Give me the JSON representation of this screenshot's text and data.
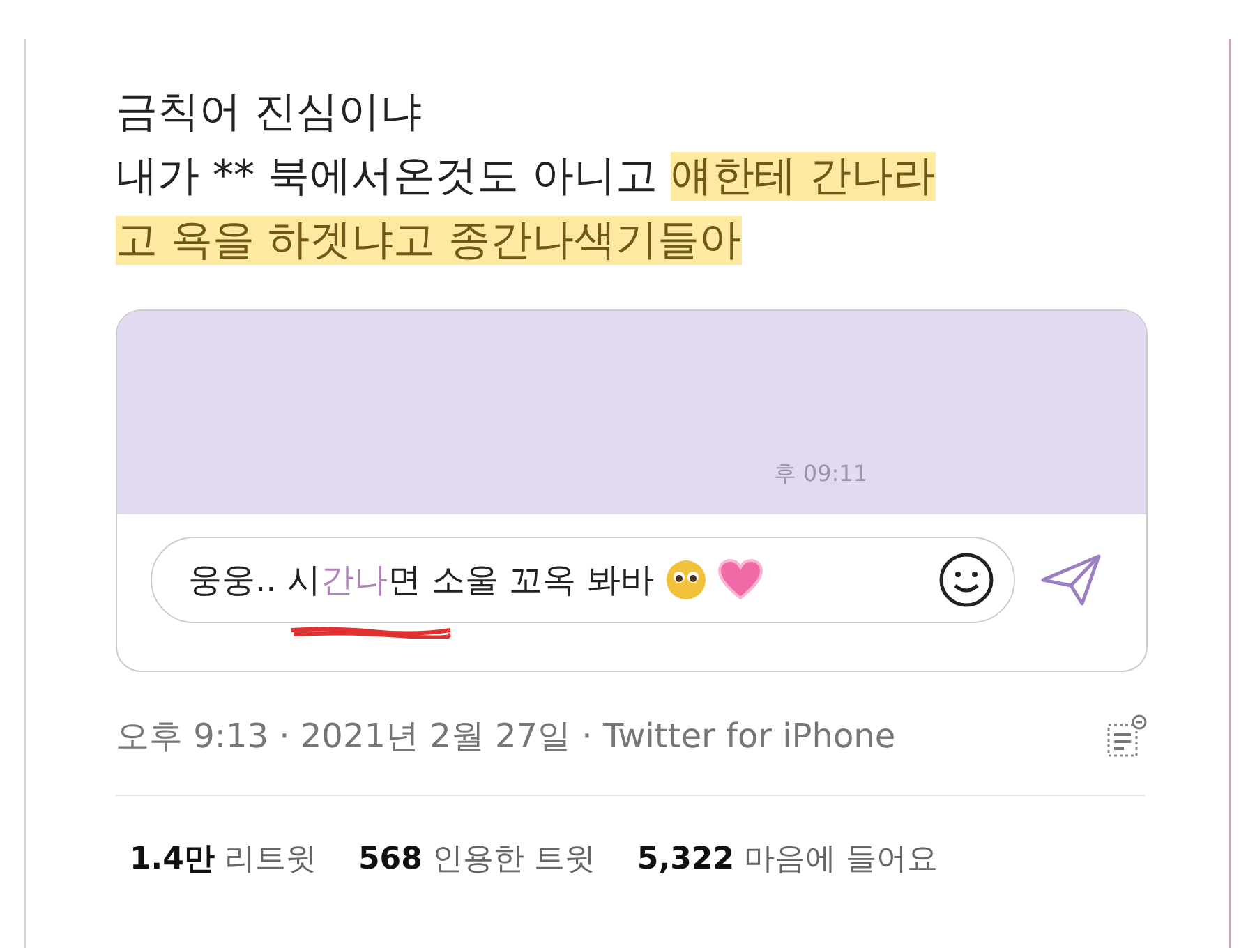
{
  "tweet": {
    "lines": [
      {
        "segments": [
          {
            "text": "금칙어 진심이냐",
            "highlighted": false
          }
        ]
      },
      {
        "segments": [
          {
            "text": "내가 ** 북에서온것도 아니고 ",
            "highlighted": false
          },
          {
            "text": "얘한테 간나라",
            "highlighted": true
          }
        ]
      },
      {
        "segments": [
          {
            "text": "고 욕을 하겟냐고 종간나색기들아",
            "highlighted": true
          }
        ]
      }
    ]
  },
  "chat": {
    "timestamp": "후 09:11",
    "message": {
      "segments": [
        {
          "text": "웅웅.. 시",
          "highlighted": false
        },
        {
          "text": "간나",
          "highlighted": true
        },
        {
          "text": "면 소울 꼬옥 봐바",
          "highlighted": false
        }
      ],
      "scribbled": true
    }
  },
  "meta": {
    "text": "오후 9:13 · 2021년 2월 27일 · Twitter for iPhone"
  },
  "stats": [
    {
      "count": "1.4만",
      "label": "리트윗"
    },
    {
      "count": "568",
      "label": "인용한 트윗"
    },
    {
      "count": "5,322",
      "label": "마음에 들어요"
    }
  ]
}
